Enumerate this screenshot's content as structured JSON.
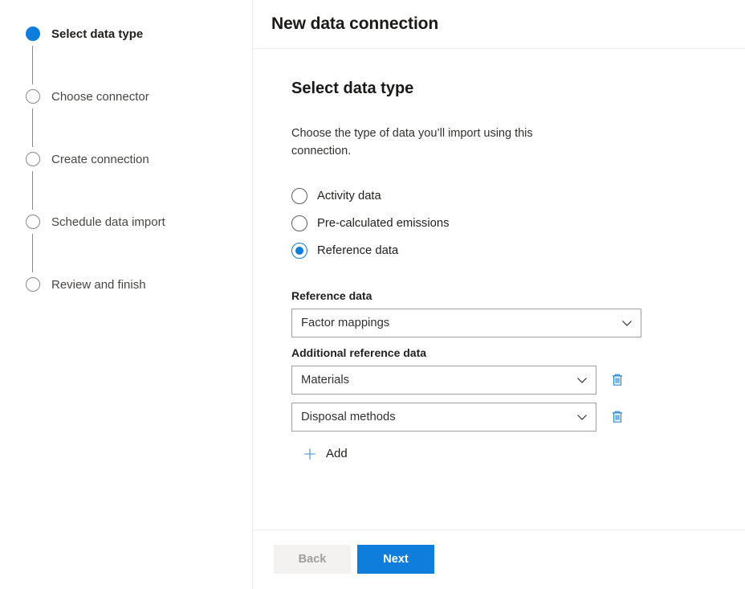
{
  "wizard": {
    "steps": [
      {
        "label": "Select data type",
        "state": "active"
      },
      {
        "label": "Choose connector",
        "state": "inactive"
      },
      {
        "label": "Create connection",
        "state": "inactive"
      },
      {
        "label": "Schedule data import",
        "state": "inactive"
      },
      {
        "label": "Review and finish",
        "state": "inactive"
      }
    ]
  },
  "header": {
    "title": "New data connection"
  },
  "main": {
    "heading": "Select data type",
    "description": "Choose the type of data you’ll import using this connection.",
    "data_type_options": [
      {
        "label": "Activity data",
        "selected": false
      },
      {
        "label": "Pre-calculated emissions",
        "selected": false
      },
      {
        "label": "Reference data",
        "selected": true
      }
    ],
    "reference_data": {
      "label": "Reference data",
      "value": "Factor mappings"
    },
    "additional_reference_data": {
      "label": "Additional reference data",
      "rows": [
        {
          "value": "Materials",
          "delete_icon": "trash-icon"
        },
        {
          "value": "Disposal methods",
          "delete_icon": "trash-icon"
        }
      ],
      "add_label": "Add",
      "add_icon": "plus-icon"
    },
    "dropdown_icon": "chevron-down-icon"
  },
  "footer": {
    "back_label": "Back",
    "next_label": "Next"
  },
  "colors": {
    "accent": "#0f7ddb",
    "icon_blue": "#2b88d8",
    "plus_blue": "#5e9fd4",
    "border": "#a19f9d",
    "divider": "#f0eeec",
    "disabled_bg": "#f3f2f1",
    "disabled_text": "#a19f9d"
  }
}
